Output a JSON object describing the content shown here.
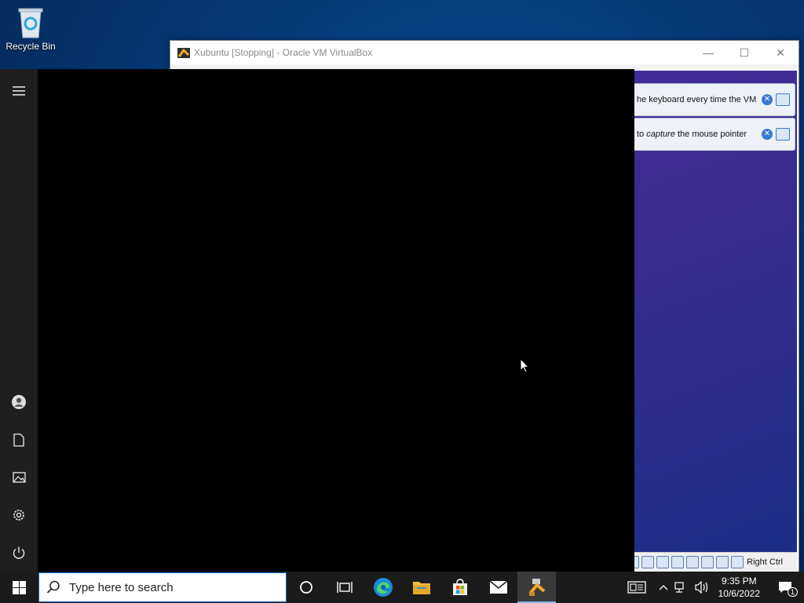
{
  "desktop": {
    "recycle_bin_label": "Recycle Bin"
  },
  "vbox": {
    "title": "Xubuntu [Stopping] - Oracle VM VirtualBox",
    "minimize_glyph": "—",
    "maximize_glyph": "☐",
    "close_glyph": "✕",
    "notifications": [
      {
        "text": "he keyboard every time the VM"
      },
      {
        "text_before": "to ",
        "text_em": "capture",
        "text_after": " the mouse pointer"
      }
    ],
    "host_key": "Right Ctrl"
  },
  "start_menu": {
    "rail": [
      "hamburger-icon",
      "user-icon",
      "documents-icon",
      "pictures-icon",
      "settings-icon",
      "power-icon"
    ]
  },
  "taskbar": {
    "search_placeholder": "Type here to search",
    "apps": [
      "cortana",
      "task-view",
      "edge",
      "file-explorer",
      "store",
      "mail",
      "virtualbox"
    ],
    "clock": {
      "time": "9:35 PM",
      "date": "10/6/2022"
    },
    "notifications_count": "1"
  },
  "colors": {
    "taskbar": "#1b1b1b",
    "accent": "#0a64c8",
    "start_rail": "#1f1f1f"
  }
}
